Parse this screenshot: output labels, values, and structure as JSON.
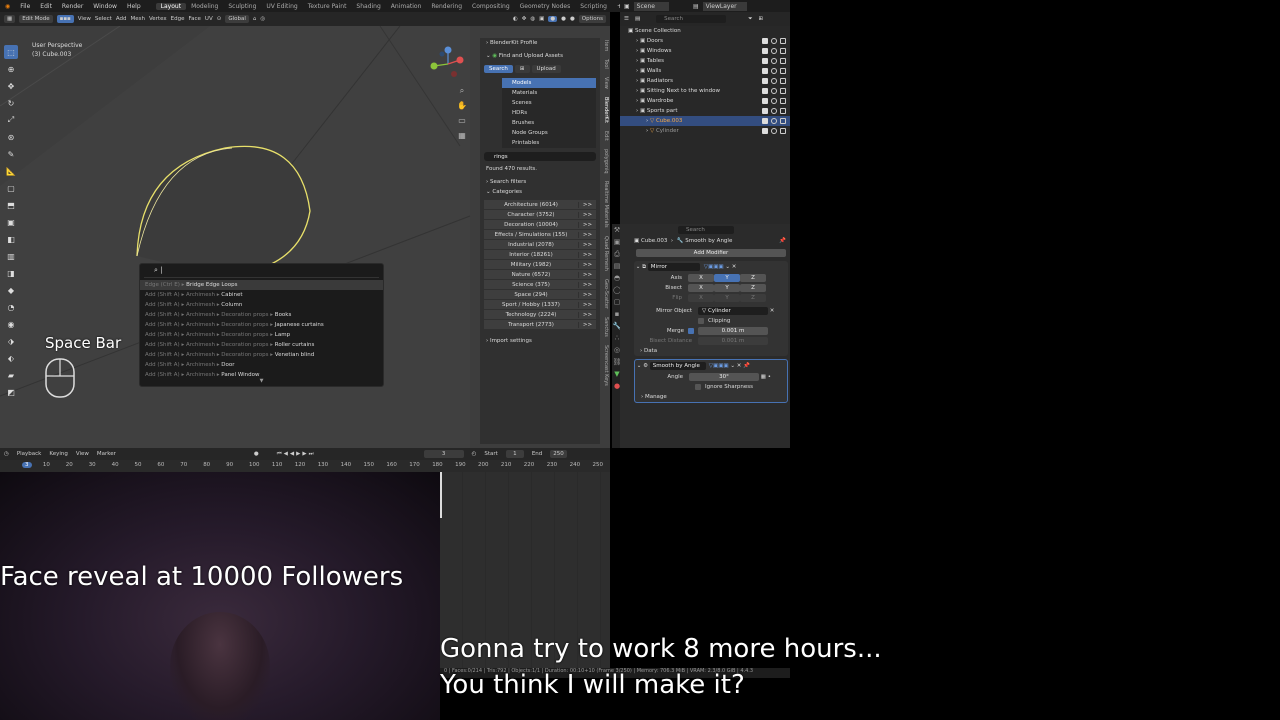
{
  "menu": {
    "items": [
      "File",
      "Edit",
      "Render",
      "Window",
      "Help"
    ],
    "tabs": [
      "Layout",
      "Modeling",
      "Sculpting",
      "UV Editing",
      "Texture Paint",
      "Shading",
      "Animation",
      "Rendering",
      "Compositing",
      "Geometry Nodes",
      "Scripting"
    ],
    "active_tab": "Layout"
  },
  "top_right": {
    "scene": "Scene",
    "view_layer": "ViewLayer"
  },
  "viewport_header": {
    "mode": "Edit Mode",
    "view": "View",
    "select": "Select",
    "add": "Add",
    "mesh": "Mesh",
    "vertex": "Vertex",
    "edge": "Edge",
    "face": "Face",
    "uv": "UV",
    "orientation": "Global",
    "options": "Options"
  },
  "viewport": {
    "perspective": "User Perspective",
    "object": "(3) Cube.003"
  },
  "blenderkit": {
    "profile": "BlenderKit Profile",
    "find": "Find and Upload Assets",
    "tab_search": "Search",
    "tab_upload": "Upload",
    "asset_types": [
      "Models",
      "Materials",
      "Scenes",
      "HDRs",
      "Brushes",
      "Node Groups",
      "Printables"
    ],
    "query": "rings",
    "found": "Found 470 results.",
    "search_filters": "Search filters",
    "categories_label": "Categories",
    "categories": [
      "Architecture (6014)",
      "Character (3752)",
      "Decoration (10004)",
      "Effects / Simulations (155)",
      "Industrial (2078)",
      "Interior (18261)",
      "Military (1982)",
      "Nature (6572)",
      "Science (375)",
      "Space (294)",
      "Sport / Hobby (1337)",
      "Technology (2224)",
      "Transport (2773)"
    ],
    "arrow": ">>",
    "import_settings": "Import settings"
  },
  "side_tabs": [
    "Item",
    "Tool",
    "View",
    "BlenderKit",
    "Edit",
    "polygoniq",
    "Realtime Materials",
    "Quad Remesh",
    "Geo-Scatter",
    "Sanctus",
    "Screencast Keys"
  ],
  "search_popup": {
    "items": [
      {
        "prefix": "Edge (Ctrl E) ▸",
        "name": "Bridge Edge Loops"
      },
      {
        "prefix": "Add (Shift A) ▸ Archimesh ▸",
        "name": "Cabinet"
      },
      {
        "prefix": "Add (Shift A) ▸ Archimesh ▸",
        "name": "Column"
      },
      {
        "prefix": "Add (Shift A) ▸ Archimesh ▸ Decoration props ▸",
        "name": "Books"
      },
      {
        "prefix": "Add (Shift A) ▸ Archimesh ▸ Decoration props ▸",
        "name": "Japanese curtains"
      },
      {
        "prefix": "Add (Shift A) ▸ Archimesh ▸ Decoration props ▸",
        "name": "Lamp"
      },
      {
        "prefix": "Add (Shift A) ▸ Archimesh ▸ Decoration props ▸",
        "name": "Roller curtains"
      },
      {
        "prefix": "Add (Shift A) ▸ Archimesh ▸ Decoration props ▸",
        "name": "Venetian blind"
      },
      {
        "prefix": "Add (Shift A) ▸ Archimesh ▸",
        "name": "Door"
      },
      {
        "prefix": "Add (Shift A) ▸ Archimesh ▸",
        "name": "Panel Window"
      }
    ]
  },
  "overlay": {
    "key": "Space Bar",
    "face_reveal": "Face reveal at 10000 Followers",
    "line1": "Gonna try to work 8 more hours...",
    "line2": "You think I will make it?"
  },
  "outliner": {
    "search_placeholder": "Search",
    "root": "Scene Collection",
    "items": [
      "Doors",
      "Windows",
      "Tables",
      "Walls",
      "Radiators",
      "Sitting Next to the window",
      "Wardrobe",
      "Sports part",
      "Cube.003",
      "Cylinder"
    ]
  },
  "properties": {
    "search_placeholder": "Search",
    "object": "Cube.003",
    "modifier_path": "Smooth by Angle",
    "add_modifier": "Add Modifier",
    "mirror": {
      "name": "Mirror",
      "axis": "Axis",
      "bisect": "Bisect",
      "flip": "Flip",
      "x": "X",
      "y": "Y",
      "z": "Z",
      "mirror_object": "Mirror Object",
      "mirror_object_value": "Cylinder",
      "clipping": "Clipping",
      "merge": "Merge",
      "merge_value": "0.001 m",
      "bisect_distance": "Bisect Distance",
      "bisect_distance_value": "0.001 m",
      "data": "Data"
    },
    "smooth": {
      "name": "Smooth by Angle",
      "angle": "Angle",
      "angle_value": "30°",
      "ignore_sharpness": "Ignore Sharpness",
      "manage": "Manage"
    }
  },
  "timeline": {
    "playback": "Playback",
    "keying": "Keying",
    "view": "View",
    "marker": "Marker",
    "frame": "3",
    "start_label": "Start",
    "start": "1",
    "end_label": "End",
    "end": "250",
    "ticks": [
      "3",
      "10",
      "20",
      "30",
      "40",
      "50",
      "60",
      "70",
      "80",
      "90",
      "100",
      "110",
      "120",
      "130",
      "140",
      "150",
      "160",
      "170",
      "180",
      "190",
      "200",
      "210",
      "220",
      "230",
      "240",
      "250"
    ]
  },
  "status": "0 | Faces:0/214 | Tris:792 | Objects:1/1 | Duration: 00:10+10 (Frame 3/250) | Memory: 706.3 MiB | VRAM: 2.3/8.0 GiB | 4.4.3",
  "colors": {
    "accent": "#4772b3",
    "viewport": "#3d3d3d",
    "panel": "#303030",
    "circle": "#e8e06a"
  }
}
